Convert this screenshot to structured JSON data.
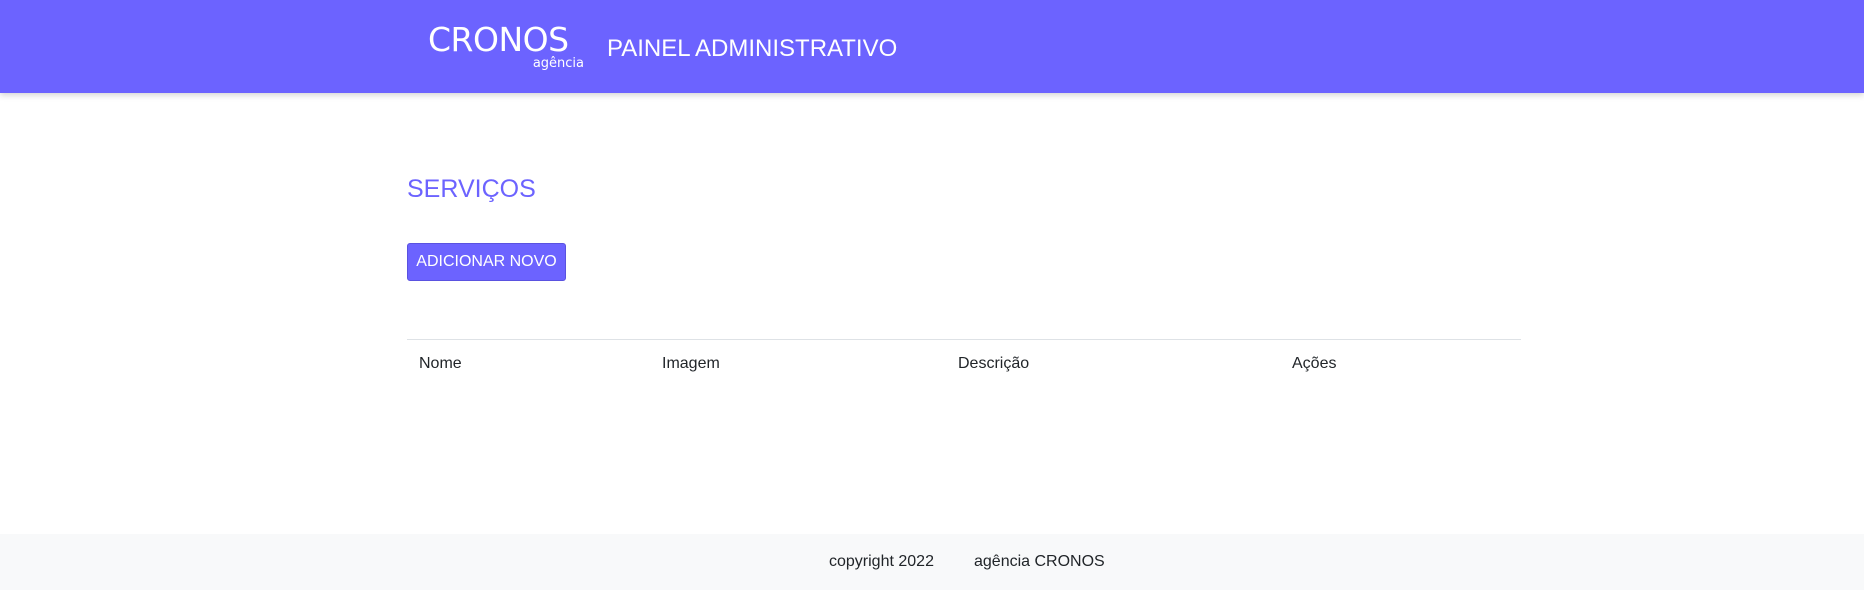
{
  "header": {
    "logo_main": "CRONOS",
    "logo_sub": "agência",
    "title": "PAINEL ADMINISTRATIVO",
    "background_color": "#6c63ff"
  },
  "main": {
    "title": "SERVIÇOS",
    "add_button_label": "ADICIONAR NOVO",
    "table": {
      "columns": [
        "Nome",
        "Imagem",
        "Descrição",
        "Ações"
      ],
      "rows": []
    }
  },
  "footer": {
    "copyright": "copyright 2022",
    "company": "agência CRONOS"
  }
}
